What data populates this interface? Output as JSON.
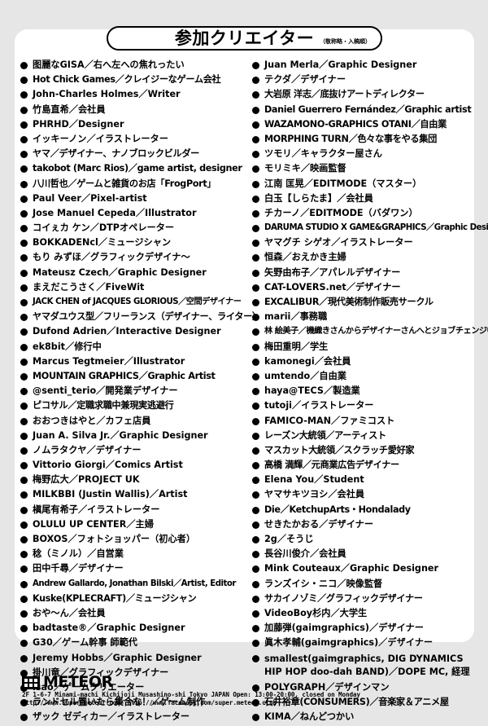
{
  "title": "参加クリエイター",
  "title_note": "（敬称略・入稿順）",
  "left_column": [
    "图麗なGISA／右へ左への焦れったい",
    "Hot Chick Games／クレイジーなゲーム会社",
    "John-Charles Holmes／Writer",
    "竹島直希／会社員",
    "PHRHD／Designer",
    "イッキーノン／イラストレーター",
    "ヤマ／デザイナー、ナノブロックビルダー",
    "takobot (Marc Rios)／game artist, designer",
    "八川哲也／ゲームと雑貨のお店「FrogPort」",
    "Paul Veer／Pixel-artist",
    "Jose Manuel Cepeda／Illustrator",
    "コイぇカ ケン／DTPオペレーター",
    "BOKKADENcl／ミュージシャン",
    "もり みずほ／グラフィックデザイナ～",
    "Mateusz Czech／Graphic Designer",
    "まえだこうさく／FiveWit",
    "JACK CHEN of JACQUES GLORIOUS／空間デザイナー",
    "ヤマダユウス型／フリーランス（デザイナー、ライター）",
    "Dufond Adrien／Interactive Designer",
    "ek8bit／修行中",
    "Marcus Tegtmeier／Illustrator",
    "MOUNTAIN GRAPHICS／Graphic Artist",
    "@senti_terio／開発業デザイナー",
    "ピコサル／定職求職中兼現実逃避行",
    "おおつきはやと／カフェ店員",
    "Juan A. Silva Jr.／Graphic Designer",
    "ノムラタクヤ／デザイナー",
    "Vittorio Giorgi／Comics Artist",
    "梅野広大／PROJECT UK",
    "MILKBBI (Justin Wallis)／Artist",
    "槇尾有希子／イラストレーター",
    "OLULU UP CENTER／主婦",
    "BOXOS／フォトショッパー（初心者）",
    "稔（ミノル）／自営業",
    "田中千尋／デザイナー",
    "Andrew Gallardo, Jonathan Bilski／Artist, Editor",
    "Kuske(KPLECRAFT)／ミュージシャン",
    "おや～ん／会社員",
    "badtaste®／Graphic Designer",
    "G30／ゲーム幹事 師範代",
    "Jeremy Hobbs／Graphic Designer",
    "掛川竜／グラフィックデザイナー",
    "isao／ゲームクリエーター",
    "ランドセル置いたら集合な！／ゲーム制作",
    "ザック ゼディカー／イラストレーター"
  ],
  "right_column": [
    "Juan Merla／Graphic Designer",
    "テクダ／デザイナー",
    "大岩原 洋志／底抜けアートディレクター",
    "Daniel Guerrero Fernández／Graphic artist",
    "WAZAMONO-GRAPHICS OTANI／自由業",
    "MORPHING TURN／色々な事をやる集団",
    "ツモリ／キャラクター屋さん",
    "モリミキ／映画監督",
    "江南 匡晃／EDITMODE（マスター）",
    "白玉【しらたま】／会社員",
    "チカーノ／EDITMODE（バダワン）",
    "DARUMA STUDIO X GAME&GRAPHICS／Graphic Designer",
    "ヤマグチ シゲオ／イラストレーター",
    "恒森／おえかき主婦",
    "矢野由布子／アパレルデザイナー",
    "CAT-LOVERS.net／デザイナー",
    "EXCALIBUR／現代美術制作販売サークル",
    "marii／事務職",
    "林 絵美子／機織きさんからデザイナーさんへとジョブチェンジ中",
    "梅田重明／学生",
    "kamonegi／会社員",
    "umtendo／自由業",
    "haya@TECS／製造業",
    "tutoji／イラストレーター",
    "FAMICO-MAN／ファミコスト",
    "レーズン大統領／アーティスト",
    "マスカット大統領／スクラッチ愛好家",
    "高橋 満輝／元商業広告デザイナー",
    "Elena You／Student",
    "ヤマサキツヨシ／会社員",
    "Die／KetchupArts・Hondalady",
    "せきたかおる／デザイナー",
    "2g／そうじ",
    "長谷川俊介／会社員",
    "Mink Couteaux／Graphic Designer",
    "ランズイシ・ニコ／映像監督",
    "サカイノゾミ／グラフィックデザイナー",
    "VideoBoy杉内／大学生",
    "加藤弾(gaimgraphics)／デザイナー",
    "眞木孝輔(gaimgraphics)／デザイナー",
    "smallest(gaimgraphics, DIG DYNAMICS HIP HOP doo-dah BAND)／DOPE MC, 経理",
    "POLYGRAPH／デザインマン",
    "石井裕章(CONSUMERS)／音楽家＆アニメ屋",
    "KIMA／ねんどつかい"
  ],
  "footer": {
    "logo_text": "METEOR",
    "logo_icon": "meteor-logo-icon",
    "address_line": "2F 1-6-7 Minami-machi Kichijoji Musashino-shi Tokyo JAPAN   Open: 13:00-20:00, closed on Monday",
    "url_line": "http://www.super-meteor.com/   http://www.facebook.com/super.meteor.club"
  }
}
